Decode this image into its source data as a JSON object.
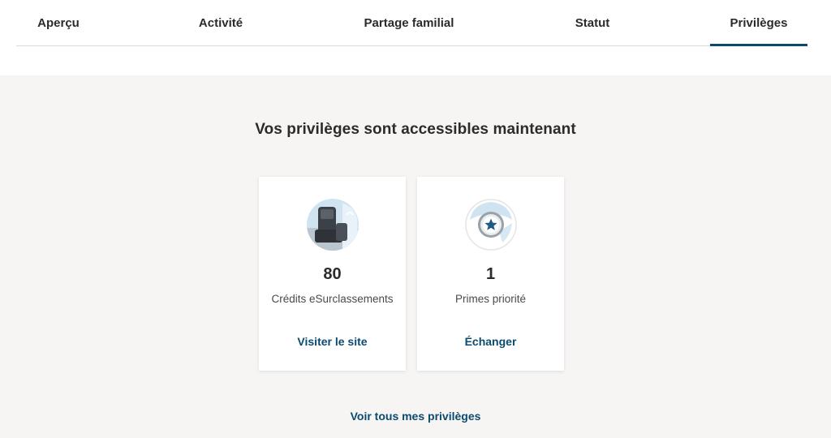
{
  "tabs": [
    {
      "label": "Aperçu"
    },
    {
      "label": "Activité"
    },
    {
      "label": "Partage familial"
    },
    {
      "label": "Statut"
    },
    {
      "label": "Privilèges",
      "active": true
    }
  ],
  "main": {
    "heading": "Vos privilèges sont accessibles maintenant",
    "cards": [
      {
        "value": "80",
        "label": "Crédits eSurclassements",
        "link": "Visiter le site",
        "icon": "seat-icon"
      },
      {
        "value": "1",
        "label": "Primes priorité",
        "link": "Échanger",
        "icon": "star-badge-icon"
      }
    ],
    "all_link": "Voir tous mes privilèges"
  },
  "colors": {
    "accent": "#0b4a6f",
    "panel_bg": "#f6f5f3",
    "tab_underline": "#0b4a6f"
  }
}
